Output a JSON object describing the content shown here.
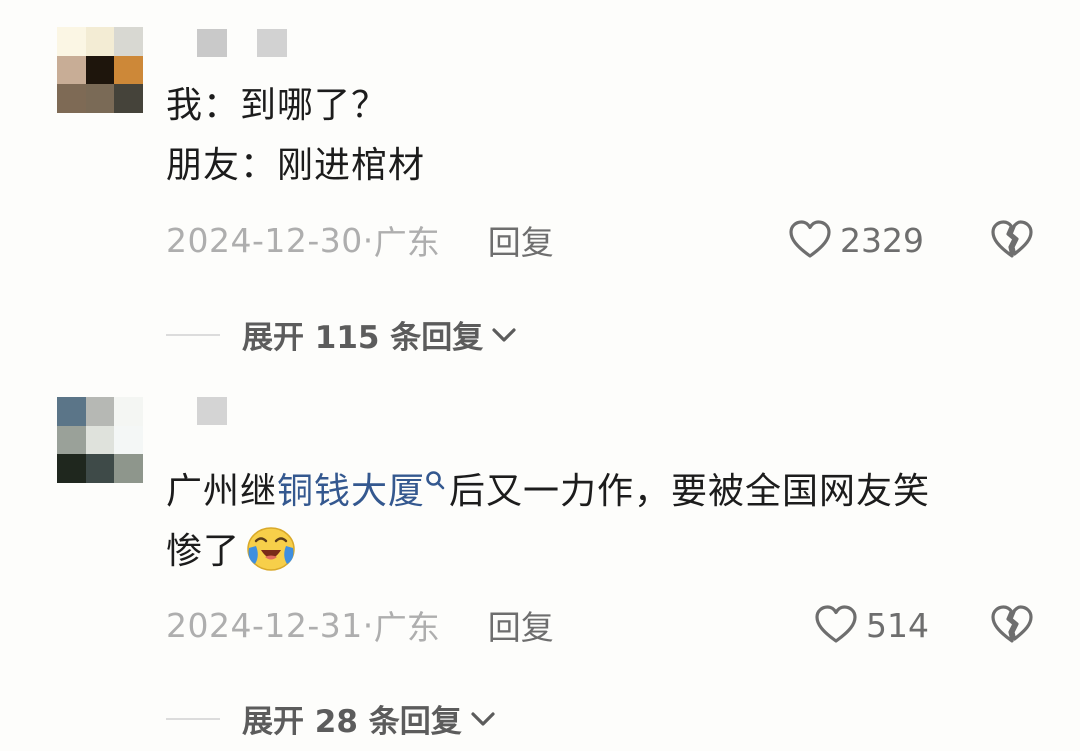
{
  "comments": [
    {
      "lines": [
        [
          "我：到哪了？"
        ],
        [
          "朋友：刚进棺材"
        ]
      ],
      "date": "2024-12-30·",
      "location": "广东",
      "reply_label": "回复",
      "likes": "2329",
      "expand_label": "展开 115 条回复"
    },
    {
      "line1_before": "广州继",
      "line1_link": "铜钱大厦",
      "line1_after": "后又一力作，要被全国网友笑",
      "line2": "惨了",
      "emoji": "crying-laughing-emoji",
      "date": "2024-12-31·",
      "location": "广东",
      "reply_label": "回复",
      "likes": "514",
      "expand_label": "展开 28 条回复"
    }
  ],
  "colors": {
    "background": "#fdfdfb",
    "text": "#1c1c1c",
    "meta": "#aeaeae",
    "link": "#34588f",
    "action": "#6e6e6e"
  },
  "icons": [
    "heart-icon",
    "broken-heart-icon",
    "chevron-down-icon",
    "search-icon"
  ]
}
